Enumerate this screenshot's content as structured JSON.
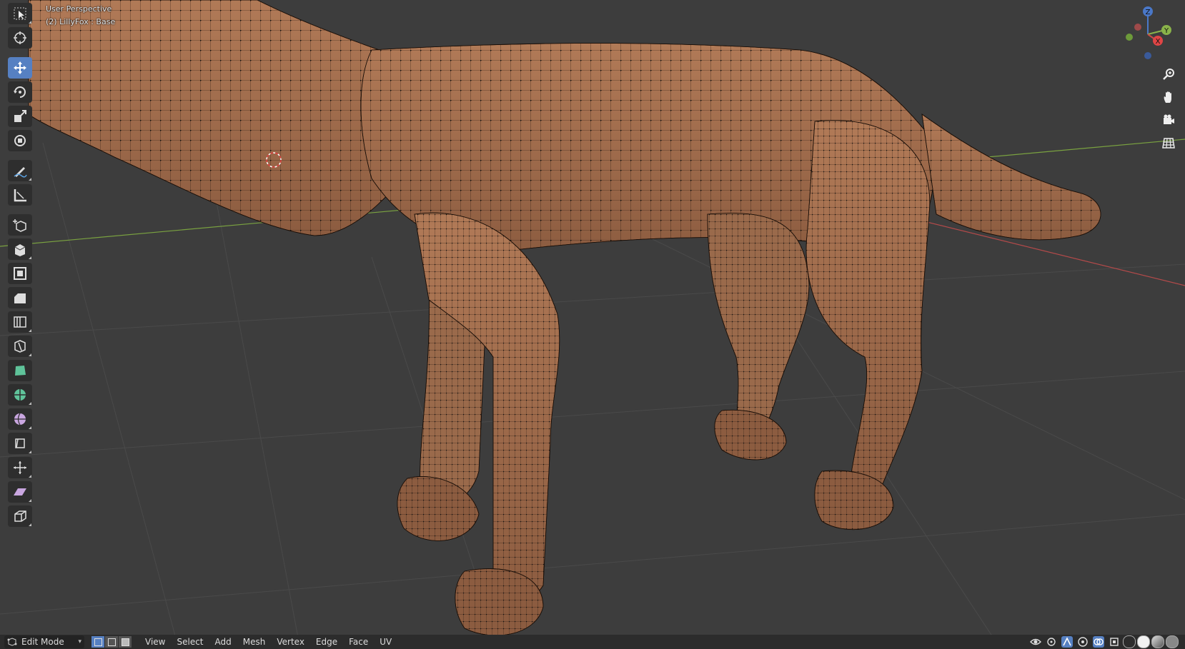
{
  "viewport": {
    "view_label": "User Perspective",
    "object_label": "(2) LillyFox : Base"
  },
  "toolbar": {
    "tools": [
      {
        "name": "select-box-icon",
        "active": false
      },
      {
        "name": "cursor-icon",
        "active": false
      },
      {
        "name": "move-icon",
        "active": true
      },
      {
        "name": "rotate-icon",
        "active": false
      },
      {
        "name": "scale-icon",
        "active": false
      },
      {
        "name": "transform-icon",
        "active": false
      },
      {
        "name": "annotate-icon",
        "active": false
      },
      {
        "name": "measure-icon",
        "active": false
      },
      {
        "name": "add-cube-icon",
        "active": false
      },
      {
        "name": "extrude-icon",
        "active": false
      },
      {
        "name": "inset-icon",
        "active": false
      },
      {
        "name": "bevel-icon",
        "active": false
      },
      {
        "name": "loop-cut-icon",
        "active": false
      },
      {
        "name": "knife-icon",
        "active": false
      },
      {
        "name": "poly-build-icon",
        "active": false
      },
      {
        "name": "spin-icon",
        "active": false
      },
      {
        "name": "smooth-icon",
        "active": false
      },
      {
        "name": "edge-slide-icon",
        "active": false
      },
      {
        "name": "shrink-fatten-icon",
        "active": false
      },
      {
        "name": "shear-icon",
        "active": false
      },
      {
        "name": "rip-icon",
        "active": false
      }
    ]
  },
  "gizmo": {
    "z_label": "Z",
    "y_label": "Y",
    "x_label": "X"
  },
  "nav": {
    "items": [
      "zoom-icon",
      "pan-hand-icon",
      "camera-icon",
      "grid-view-icon"
    ]
  },
  "header": {
    "mode": "Edit Mode",
    "menu": {
      "view": "View",
      "select": "Select",
      "add": "Add",
      "mesh": "Mesh",
      "vertex": "Vertex",
      "edge": "Edge",
      "face": "Face",
      "uv": "UV"
    }
  },
  "colors": {
    "background": "#3d3d3d",
    "mesh_fill": "#a06e4f",
    "accent_active": "#5680c2",
    "axis_x": "#c84a4a",
    "axis_y": "#8ab34a",
    "axis_z": "#4a78c8"
  }
}
